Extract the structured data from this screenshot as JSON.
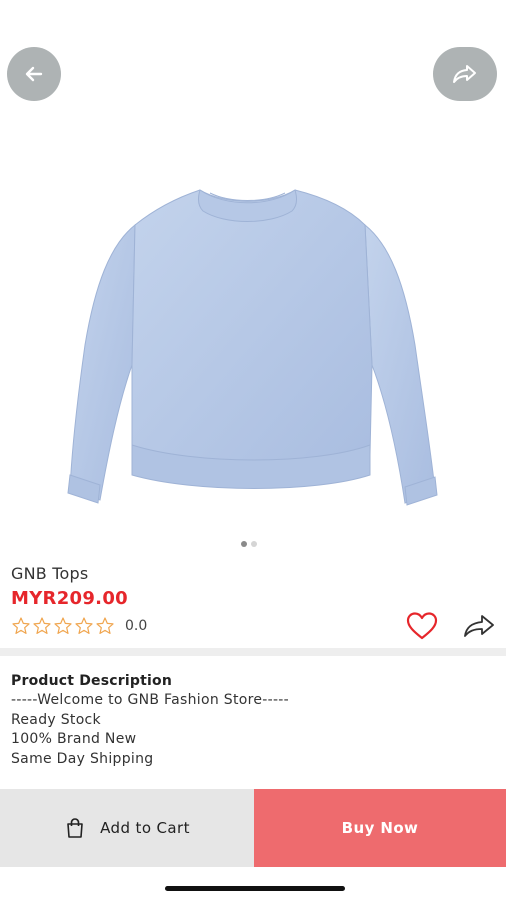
{
  "product": {
    "title": "GNB Tops",
    "price": "MYR209.00",
    "rating_value": "0.0",
    "rating_stars": 0,
    "rating_max": 5
  },
  "gallery": {
    "image": "light blue crewneck sweatshirt",
    "total_images": 2,
    "active_index": 0
  },
  "description": {
    "title": "Product Description",
    "lines": [
      "-----Welcome to GNB Fashion Store-----",
      "Ready Stock",
      "100% Brand New",
      "Same Day Shipping"
    ]
  },
  "actions": {
    "add_to_cart_label": "Add to Cart",
    "buy_now_label": "Buy Now"
  },
  "icons": {
    "back": "arrow-left-icon",
    "share_top": "share-arrow-icon",
    "favorite": "heart-outline-icon",
    "share": "share-arrow-icon",
    "cart": "shopping-bag-icon",
    "star": "star-outline-icon"
  },
  "colors": {
    "price": "#e6262b",
    "buy_now_bg": "#ee6b6e",
    "add_to_cart_bg": "#e6e6e6",
    "star": "#f0a650",
    "heart": "#e6262b",
    "circle_button": "#aeb3b4",
    "sweatshirt": "#b5c8e6"
  }
}
